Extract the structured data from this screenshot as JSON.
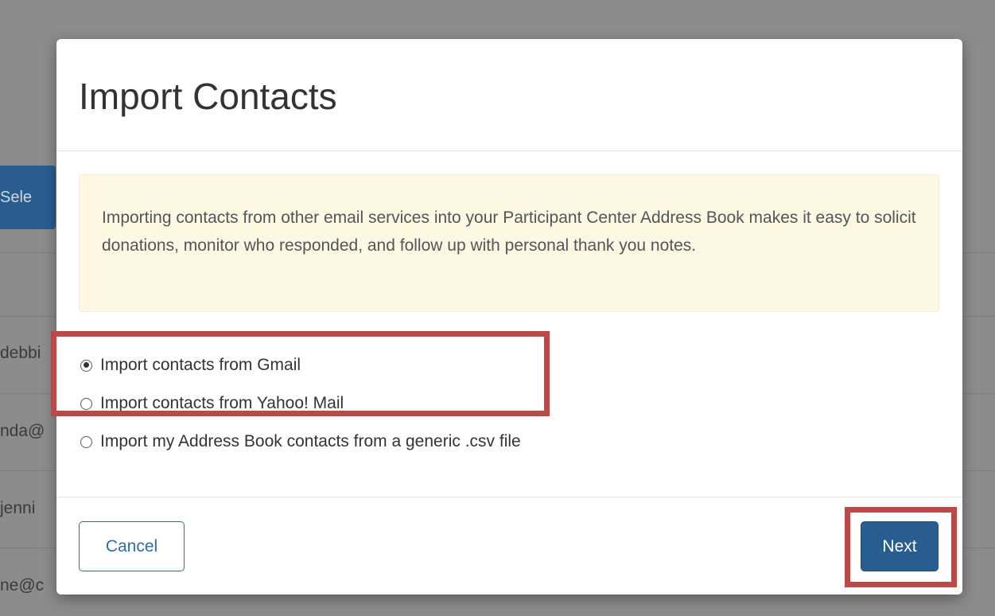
{
  "background": {
    "select_button_label": "Sele",
    "emails": [
      "debbi",
      "nda@",
      "jenni",
      "ne@c"
    ]
  },
  "modal": {
    "title": "Import Contacts",
    "info_text": "Importing contacts from other email services into your Participant Center Address Book makes it easy to solicit donations, monitor who responded, and follow up with personal thank you notes.",
    "options": [
      {
        "label": "Import contacts from Gmail",
        "checked": true
      },
      {
        "label": "Import contacts from Yahoo! Mail",
        "checked": false
      },
      {
        "label": "Import my Address Book contacts from a generic .csv file",
        "checked": false
      }
    ],
    "cancel_label": "Cancel",
    "next_label": "Next"
  },
  "colors": {
    "primary": "#2a5d8f",
    "alert_bg": "#fcf8e3",
    "highlight": "#b84a4a",
    "backdrop": "#8c8c8c"
  }
}
